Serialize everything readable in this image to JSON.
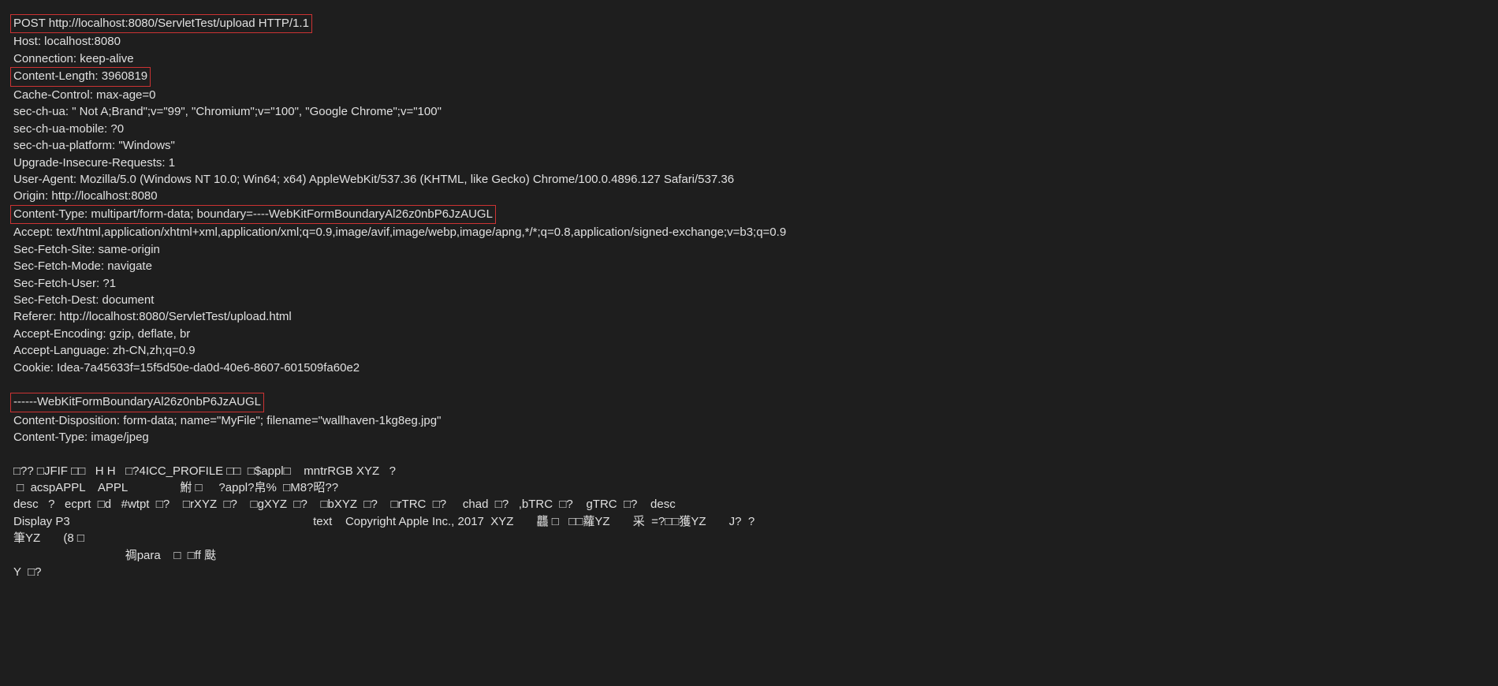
{
  "http": {
    "request_line": "POST http://localhost:8080/ServletTest/upload HTTP/1.1",
    "headers": [
      "Host: localhost:8080",
      "Connection: keep-alive",
      "Content-Length: 3960819",
      "Cache-Control: max-age=0",
      "sec-ch-ua: \" Not A;Brand\";v=\"99\", \"Chromium\";v=\"100\", \"Google Chrome\";v=\"100\"",
      "sec-ch-ua-mobile: ?0",
      "sec-ch-ua-platform: \"Windows\"",
      "Upgrade-Insecure-Requests: 1",
      "User-Agent: Mozilla/5.0 (Windows NT 10.0; Win64; x64) AppleWebKit/537.36 (KHTML, like Gecko) Chrome/100.0.4896.127 Safari/537.36",
      "Origin: http://localhost:8080",
      "Content-Type: multipart/form-data; boundary=----WebKitFormBoundaryAl26z0nbP6JzAUGL",
      "Accept: text/html,application/xhtml+xml,application/xml;q=0.9,image/avif,image/webp,image/apng,*/*;q=0.8,application/signed-exchange;v=b3;q=0.9",
      "Sec-Fetch-Site: same-origin",
      "Sec-Fetch-Mode: navigate",
      "Sec-Fetch-User: ?1",
      "Sec-Fetch-Dest: document",
      "Referer: http://localhost:8080/ServletTest/upload.html",
      "Accept-Encoding: gzip, deflate, br",
      "Accept-Language: zh-CN,zh;q=0.9",
      "Cookie: Idea-7a45633f=15f5d50e-da0d-40e6-8607-601509fa60e2"
    ],
    "body": {
      "boundary": "------WebKitFormBoundaryAl26z0nbP6JzAUGL",
      "disposition": "Content-Disposition: form-data; name=\"MyFile\"; filename=\"wallhaven-1kg8eg.jpg\"",
      "content_type": "Content-Type: image/jpeg",
      "binary": [
        "□?? □JFIF □□   H H   □?4ICC_PROFILE □□  □$appl□    mntrRGB XYZ   ?",
        " □  acspAPPL    APPL                鮒 □     ?appl?帛%  □M8?昭??",
        "desc   ?   ecprt  □d   #wtpt  □?    □rXYZ  □?    □gXYZ  □?    □bXYZ  □?    □rTRC  □?     chad  □?   ,bTRC  □?    gTRC  □?    desc                                       ",
        "Display P3                                                                          text    Copyright Apple Inc., 2017  XYZ       龘 □   □□蘿YZ       采  =?□□獲YZ       J?  ?",
        "筆YZ       (8 □",
        "                                  禂para    □  □ff 颫",
        "Y  □?"
      ]
    }
  }
}
